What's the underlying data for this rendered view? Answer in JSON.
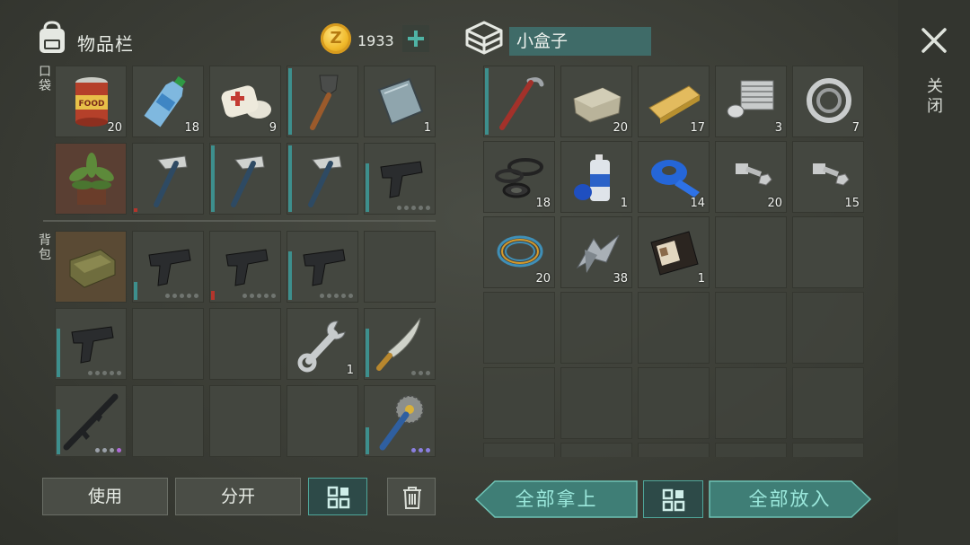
{
  "inventory": {
    "title": "物品栏",
    "pocket_label": "口袋",
    "backpack_label": "背包",
    "coins": "1933",
    "icon": "backpack-icon"
  },
  "container": {
    "title": "小盒子",
    "close_label": "关闭",
    "icon": "box-icon"
  },
  "pocket_slots": [
    {
      "item": "canned-food",
      "count": "20"
    },
    {
      "item": "water-bottle",
      "count": "18"
    },
    {
      "item": "bandage",
      "count": "9"
    },
    {
      "item": "shovel",
      "count": ""
    },
    {
      "item": "metal-plate",
      "count": "1"
    },
    {
      "item": "potted-plant",
      "count": ""
    },
    {
      "item": "hatchet",
      "count": ""
    },
    {
      "item": "hatchet",
      "count": ""
    },
    {
      "item": "hatchet",
      "count": ""
    },
    {
      "item": "pistol",
      "count": ""
    }
  ],
  "backpack_slots": [
    {
      "item": "sofa",
      "count": ""
    },
    {
      "item": "pistol",
      "count": ""
    },
    {
      "item": "pistol",
      "count": ""
    },
    {
      "item": "pistol",
      "count": ""
    },
    {
      "item": "",
      "count": ""
    },
    {
      "item": "pistol",
      "count": ""
    },
    {
      "item": "",
      "count": ""
    },
    {
      "item": "",
      "count": ""
    },
    {
      "item": "wrench",
      "count": "1"
    },
    {
      "item": "machete",
      "count": ""
    },
    {
      "item": "assault-rifle",
      "count": ""
    },
    {
      "item": "",
      "count": ""
    },
    {
      "item": "",
      "count": ""
    },
    {
      "item": "",
      "count": ""
    },
    {
      "item": "saw-blade-mace",
      "count": ""
    }
  ],
  "box_slots": [
    {
      "item": "crowbar",
      "count": ""
    },
    {
      "item": "stone",
      "count": "20"
    },
    {
      "item": "wood-plank",
      "count": "17"
    },
    {
      "item": "engine-cylinder",
      "count": "3"
    },
    {
      "item": "bearing",
      "count": "7"
    },
    {
      "item": "rubber-seals",
      "count": "18"
    },
    {
      "item": "spray-paint",
      "count": "1"
    },
    {
      "item": "blue-tape",
      "count": "14"
    },
    {
      "item": "bolts-nuts",
      "count": "20"
    },
    {
      "item": "bolts-nuts",
      "count": "15"
    },
    {
      "item": "wire-coil",
      "count": "20"
    },
    {
      "item": "metal-scraps",
      "count": "38"
    },
    {
      "item": "id-wallet",
      "count": "1"
    }
  ],
  "buttons": {
    "use": "使用",
    "split": "分开",
    "take_all": "全部拿上",
    "put_all": "全部放入",
    "sort_icon": "grid-sort-icon",
    "trash_icon": "trash-icon"
  },
  "colors": {
    "accent": "#4fb3a5",
    "slot_bg": "#444740",
    "durability": "#3d8f8d",
    "durability_low": "#b3352c"
  }
}
